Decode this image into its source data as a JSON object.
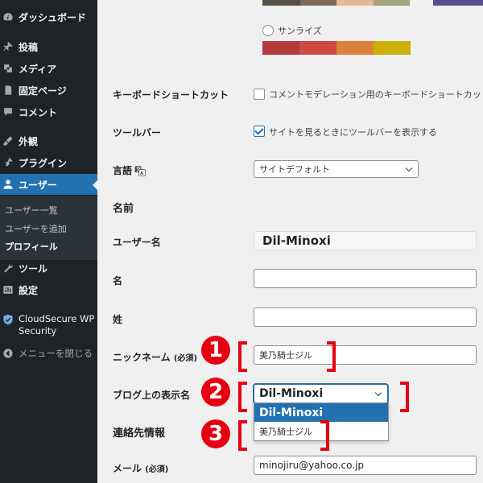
{
  "sidebar": {
    "items": [
      {
        "label": "ダッシュボード",
        "icon": "dashboard-icon"
      },
      {
        "label": "投稿",
        "icon": "pin-icon"
      },
      {
        "label": "メディア",
        "icon": "media-icon"
      },
      {
        "label": "固定ページ",
        "icon": "page-icon"
      },
      {
        "label": "コメント",
        "icon": "comment-icon"
      },
      {
        "label": "外観",
        "icon": "appearance-icon"
      },
      {
        "label": "プラグイン",
        "icon": "plugin-icon"
      },
      {
        "label": "ユーザー",
        "icon": "user-icon"
      },
      {
        "label": "ツール",
        "icon": "wrench-icon"
      },
      {
        "label": "設定",
        "icon": "settings-icon"
      }
    ],
    "active_item": "ユーザー",
    "submenu": [
      "ユーザー一覧",
      "ユーザーを追加",
      "プロフィール"
    ],
    "current_submenu": "プロフィール",
    "cloudsecure": {
      "line1": "CloudSecure WP",
      "line2": "Security"
    },
    "collapse_label": "メニューを閉じる"
  },
  "color_schemes": {
    "sunrise_label": "サンライズ",
    "top_colors": [
      "#555048",
      "#796a5a",
      "#e5b898",
      "#a3a57e"
    ],
    "top_right_color": "#5a4e8c",
    "sunrise_colors": [
      "#b43c38",
      "#cf4944",
      "#dd823b",
      "#ccaf0b"
    ]
  },
  "keyboard_shortcuts": {
    "label": "キーボードショートカット",
    "checkbox_text": "コメントモデレーション用のキーボードショートカッ",
    "checked": false
  },
  "toolbar": {
    "label": "ツールバー",
    "checkbox_text": "サイトを見るときにツールバーを表示する",
    "checked": true
  },
  "language": {
    "label": "言語",
    "value": "サイトデフォルト"
  },
  "name_section": {
    "heading": "名前",
    "username_label": "ユーザー名",
    "username_value": "Dil-Minoxi",
    "first_name_label": "名",
    "first_name_value": "",
    "last_name_label": "姓",
    "last_name_value": "",
    "nickname_label": "ニックネーム",
    "nickname_required": "(必須)",
    "nickname_value": "美乃騎士ジル",
    "display_name_label": "ブログ上の表示名",
    "display_name_value": "Dil-Minoxi",
    "display_name_options": [
      "Dil-Minoxi",
      "美乃騎士ジル"
    ]
  },
  "contact_section": {
    "heading": "連絡先情報",
    "email_label": "メール",
    "email_required": "(必須)",
    "email_value": "minojiru@yahoo.co.jp"
  },
  "annotations": {
    "badge1": "1",
    "badge2": "2",
    "badge3": "3",
    "color": "#e60012"
  }
}
